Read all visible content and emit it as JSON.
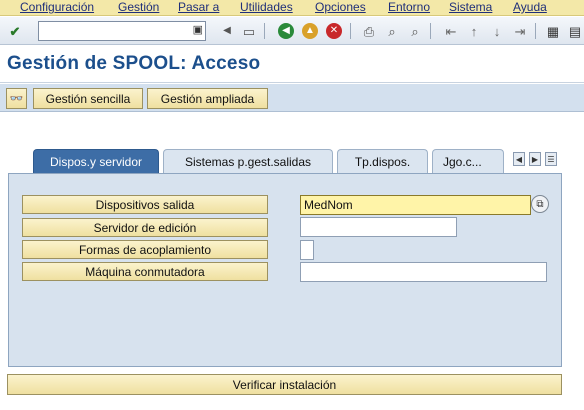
{
  "menu": [
    "Configuración",
    "Gestión",
    "Pasar a",
    "Utilidades",
    "Opciones",
    "Entorno",
    "Sistema",
    "Ayuda"
  ],
  "toolbar": {
    "command_value": "",
    "icons": [
      "enter-icon",
      "back-icon",
      "exit-icon",
      "cancel-icon",
      "print-icon",
      "find-icon",
      "find-next-icon",
      "first-page-icon",
      "prev-page-icon",
      "next-page-icon",
      "last-page-icon",
      "create-session-icon",
      "shortcut-icon"
    ]
  },
  "title": "Gestión de SPOOL: Acceso",
  "app_toolbar": {
    "simple": "Gestión sencilla",
    "extended": "Gestión ampliada"
  },
  "tabs": [
    {
      "label": "Dispos.y servidor",
      "active": true
    },
    {
      "label": "Sistemas p.gest.salidas",
      "active": false
    },
    {
      "label": "Tp.dispos.",
      "active": false
    },
    {
      "label": "Jgo.c...",
      "active": false
    }
  ],
  "fields": [
    {
      "label": "Dispositivos salida",
      "value": "MedNom"
    },
    {
      "label": "Servidor de edición",
      "value": ""
    },
    {
      "label": "Formas de acoplamiento",
      "value": ""
    },
    {
      "label": "Máquina conmutadora",
      "value": ""
    }
  ],
  "verify": "Verificar instalación",
  "colors": {
    "menubar": "#f3e8a8",
    "title": "#1c4f8c",
    "active_tab": "#3d6da6",
    "panel": "#d7e2ee",
    "button": "#f3e6ad"
  }
}
